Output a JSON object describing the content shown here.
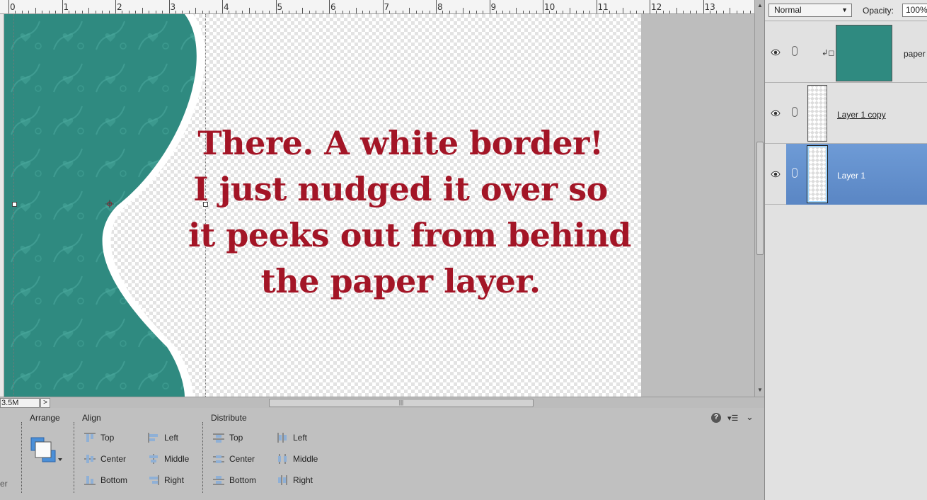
{
  "ruler": {
    "labels": [
      "0",
      "1",
      "2",
      "3",
      "4",
      "5",
      "6",
      "7",
      "8",
      "9",
      "10",
      "11",
      "12",
      "13"
    ]
  },
  "canvas": {
    "text_lines": [
      "There. A white border!",
      "I just nudged it over so",
      "it peeks out from behind",
      "the paper layer."
    ],
    "text_color": "#a31526",
    "paper_color": "#2f8a80"
  },
  "status": {
    "doc_size": "3.5M",
    "expand": ">"
  },
  "layers_panel": {
    "blend_mode": "Normal",
    "opacity_label": "Opacity:",
    "opacity_value": "100%",
    "layers": [
      {
        "name": "paper",
        "visible": true,
        "clipped": true,
        "selected": false
      },
      {
        "name": "Layer 1 copy",
        "visible": true,
        "clipped": false,
        "selected": false
      },
      {
        "name": "Layer 1",
        "visible": true,
        "clipped": false,
        "selected": true
      }
    ],
    "selection_color": "#6e9bd6"
  },
  "tool_options": {
    "left_cut_label": "er",
    "arrange": {
      "title": "Arrange"
    },
    "align": {
      "title": "Align",
      "buttons": [
        "Top",
        "Center",
        "Bottom",
        "Left",
        "Middle",
        "Right"
      ]
    },
    "distribute": {
      "title": "Distribute",
      "buttons": [
        "Top",
        "Center",
        "Bottom",
        "Left",
        "Middle",
        "Right"
      ]
    },
    "help_label": "?"
  }
}
